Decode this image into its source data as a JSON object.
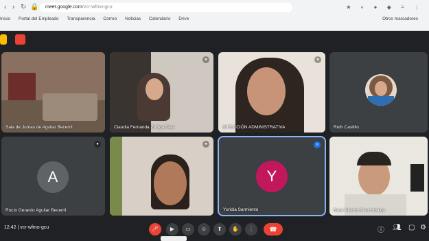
{
  "browser": {
    "url_host": "meet.google.com",
    "url_path": "/vcr-wfmo-gcu",
    "bookmarks": [
      "Inicio",
      "Portal del Empleado",
      "Transparencia",
      "Correo",
      "Noticias",
      "Calendario",
      "Drive"
    ],
    "bookmarks_right": "Otros marcadores"
  },
  "tiles": [
    {
      "name": "Sala de Juntas de Aguilar Becerril"
    },
    {
      "name": "Claudia Fernanda Zuñiga Diaz"
    },
    {
      "name": "DIRECCIÓN ADMINISTRATIVA"
    },
    {
      "name": "Ruth Castillo"
    },
    {
      "name": "Rocío Gerardo Aguilar Becerril",
      "initial": "A"
    },
    {
      "name": ""
    },
    {
      "name": "Yuridia Sarmiento",
      "initial": "Y"
    },
    {
      "name": "Raul Alberto Silva Hidalgo"
    }
  ],
  "bottom": {
    "meeting": "12:42 | vcr-wfmo-gcu"
  },
  "colors": {
    "avatar_gray": "#5f6368",
    "avatar_pink": "#c2185b",
    "accent": "#8ab4f8"
  }
}
